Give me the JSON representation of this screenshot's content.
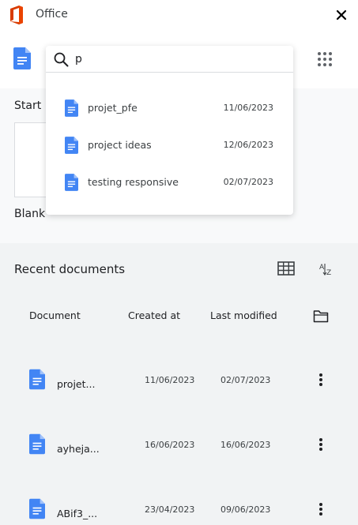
{
  "app": {
    "title": "Office"
  },
  "search": {
    "value": "p",
    "placeholder": ""
  },
  "search_results": [
    {
      "name": "projet_pfe",
      "date": "11/06/2023"
    },
    {
      "name": "project ideas",
      "date": "12/06/2023"
    },
    {
      "name": "testing responsive",
      "date": "02/07/2023"
    }
  ],
  "start": {
    "label": "Start",
    "blank_label": "Blank"
  },
  "recent": {
    "title": "Recent documents",
    "columns": {
      "document": "Document",
      "created": "Created at",
      "modified": "Last modified"
    },
    "rows": [
      {
        "name": "projet...",
        "created": "11/06/2023",
        "modified": "02/07/2023"
      },
      {
        "name": "ayheja...",
        "created": "16/06/2023",
        "modified": "16/06/2023"
      },
      {
        "name": "ABif3_...",
        "created": "23/04/2023",
        "modified": "09/06/2023"
      }
    ]
  },
  "colors": {
    "doc_blue": "#4285f4",
    "office_red": "#d83b01"
  },
  "icons": [
    "office-logo-icon",
    "close-icon",
    "docs-icon",
    "apps-grid-icon",
    "search-icon",
    "table-view-icon",
    "sort-az-icon",
    "folder-icon",
    "more-vert-icon"
  ]
}
